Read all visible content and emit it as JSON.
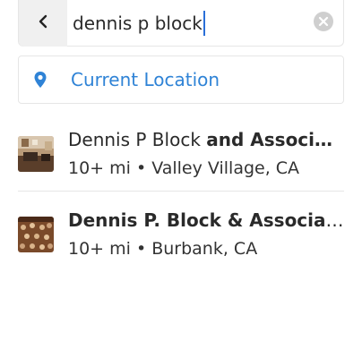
{
  "search": {
    "value": "dennis p block",
    "back_icon": "chevron-left-icon",
    "clear_icon": "clear-circle-icon"
  },
  "current_location": {
    "label": "Current Location",
    "icon": "location-pin-icon",
    "color": "#2f83d6"
  },
  "results": [
    {
      "title_plain": "Dennis P Block ",
      "title_bold": "and Associ…",
      "subtitle": "10+ mi • Valley Village, CA"
    },
    {
      "title_plain": "",
      "title_bold": "Dennis P. Block & Associat…",
      "subtitle": "10+ mi • Burbank, CA"
    }
  ]
}
